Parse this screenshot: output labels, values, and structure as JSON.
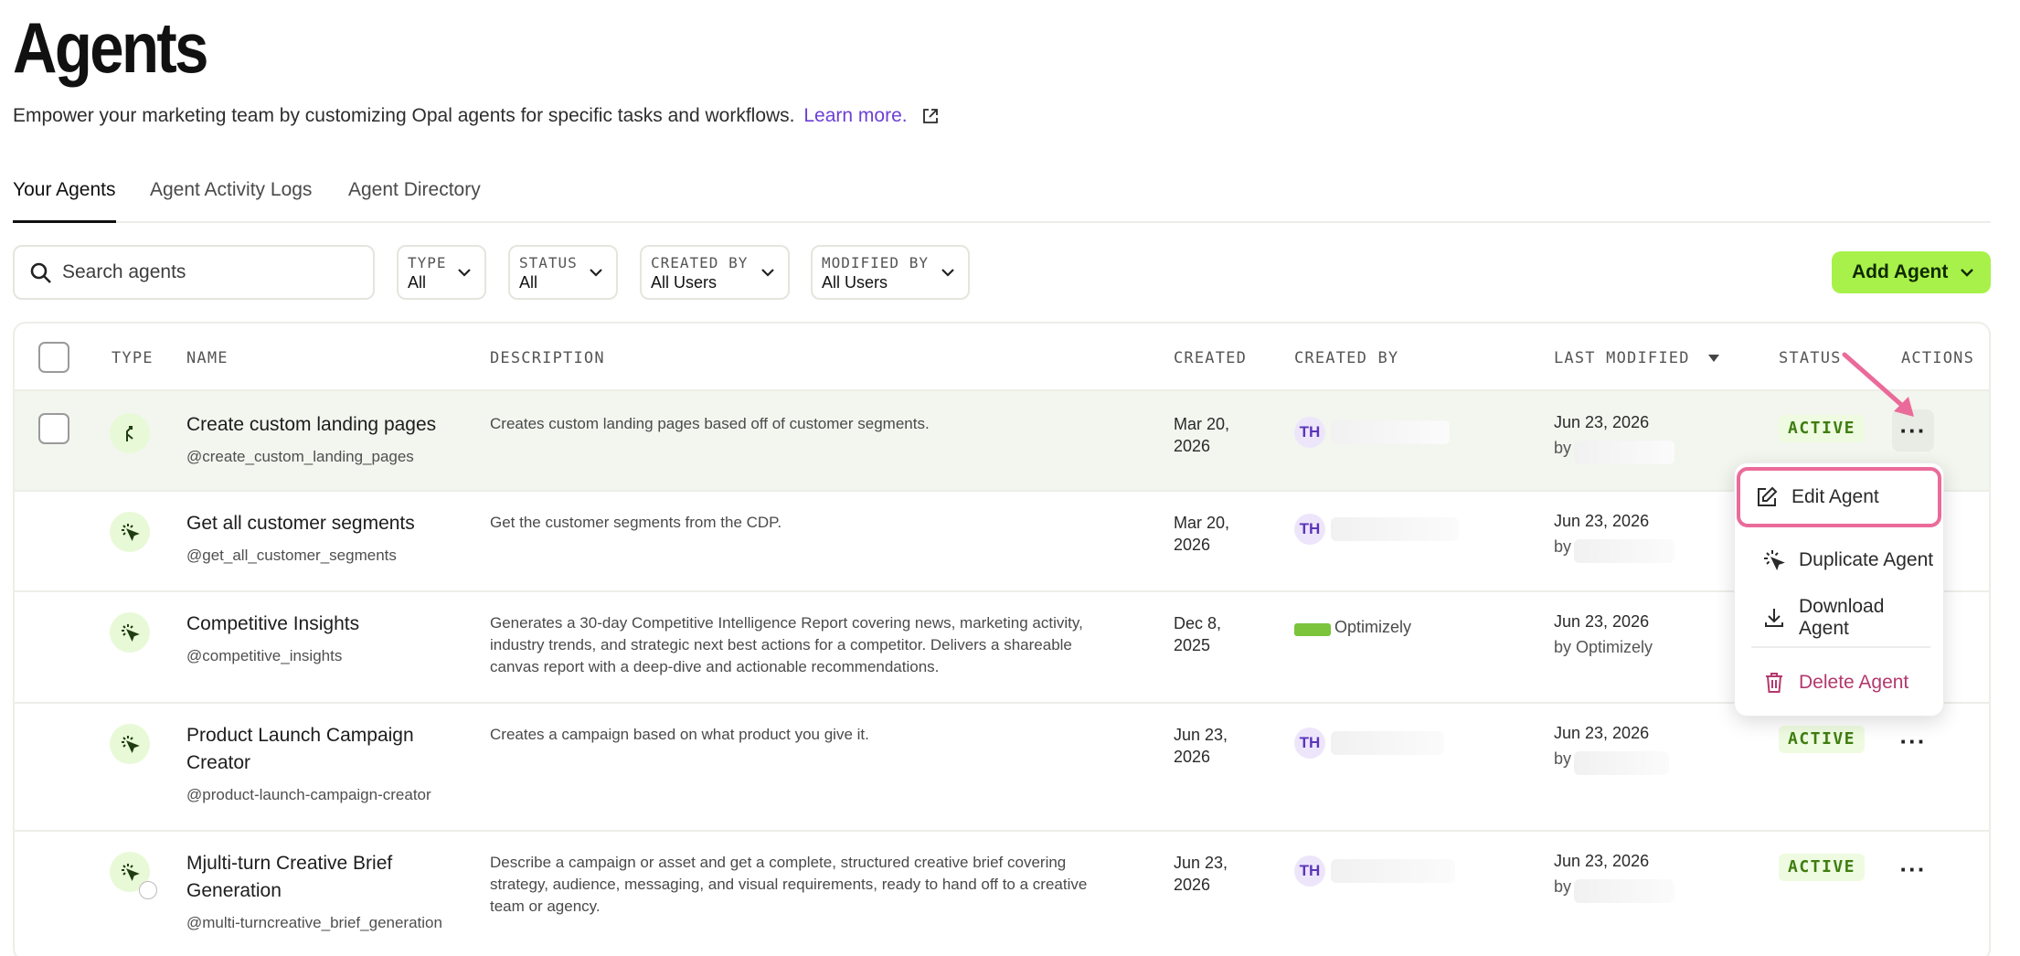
{
  "page": {
    "title": "Agents",
    "subtitle": "Empower your marketing team by customizing Opal agents for specific tasks and workflows.",
    "learn_more": "Learn more.",
    "colors": {
      "accent": "#a8f14a",
      "link": "#6c3fd4",
      "status": "#3f7d10",
      "highlight": "#ea6b9a"
    }
  },
  "tabs": [
    {
      "label": "Your Agents",
      "active": true
    },
    {
      "label": "Agent Activity Logs",
      "active": false
    },
    {
      "label": "Agent Directory",
      "active": false
    }
  ],
  "toolbar": {
    "search_placeholder": "Search agents",
    "filters": [
      {
        "label": "TYPE",
        "value": "All"
      },
      {
        "label": "STATUS",
        "value": "All"
      },
      {
        "label": "CREATED BY",
        "value": "All Users"
      },
      {
        "label": "MODIFIED BY",
        "value": "All Users"
      }
    ],
    "add_button": "Add Agent"
  },
  "table": {
    "columns": [
      "TYPE",
      "NAME",
      "DESCRIPTION",
      "CREATED",
      "CREATED BY",
      "LAST MODIFIED",
      "STATUS",
      "ACTIONS"
    ],
    "rows": [
      {
        "name": "Create custom landing pages",
        "handle": "@create_custom_landing_pages",
        "description": "Creates custom landing pages based off of customer segments.",
        "created_line1": "Mar 20,",
        "created_line2": "2026",
        "creator_initials": "TH",
        "modified": "Jun 23, 2026",
        "modified_by": "by",
        "status": "ACTIVE",
        "type_icon": "workflow-icon"
      },
      {
        "name": "Get all customer segments",
        "handle": "@get_all_customer_segments",
        "description": "Get the customer segments from the CDP.",
        "created_line1": "Mar 20,",
        "created_line2": "2026",
        "creator_initials": "TH",
        "modified": "Jun 23, 2026",
        "modified_by": "by",
        "status": "",
        "type_icon": "specialized-agent-icon"
      },
      {
        "name": "Competitive Insights",
        "handle": "@competitive_insights",
        "description": "Generates a 30-day Competitive Intelligence Report covering news, marketing activity, industry trends, and strategic next best actions for a competitor. Delivers a shareable canvas report with a deep-dive and actionable recommendations.",
        "created_line1": "Dec 8,",
        "created_line2": "2025",
        "creator_name": "Optimizely",
        "modified": "Jun 23, 2026",
        "modified_by": "by Optimizely",
        "status": "",
        "type_icon": "specialized-agent-icon"
      },
      {
        "name": "Product Launch Campaign Creator",
        "handle": "@product-launch-campaign-creator",
        "description": "Creates a campaign based on what product you give it.",
        "created_line1": "Jun 23,",
        "created_line2": "2026",
        "creator_initials": "TH",
        "modified": "Jun 23, 2026",
        "modified_by": "by",
        "status": "ACTIVE",
        "type_icon": "specialized-agent-icon"
      },
      {
        "name": "Mjulti-turn Creative Brief Generation",
        "handle": "@multi-turncreative_brief_generation",
        "description": "Describe a campaign or asset and get a complete, structured creative brief covering strategy, audience, messaging, and visual requirements, ready to hand off to a creative team or agency.",
        "created_line1": "Jun 23,",
        "created_line2": "2026",
        "creator_initials": "TH",
        "modified": "Jun 23, 2026",
        "modified_by": "by",
        "status": "ACTIVE",
        "type_icon": "specialized-agent-icon"
      }
    ]
  },
  "actions_menu": {
    "items": [
      {
        "label": "Edit Agent",
        "icon": "edit-icon"
      },
      {
        "label": "Duplicate Agent",
        "icon": "duplicate-icon"
      },
      {
        "label": "Download Agent",
        "icon": "download-icon"
      },
      {
        "label": "Delete Agent",
        "icon": "trash-icon"
      }
    ]
  }
}
